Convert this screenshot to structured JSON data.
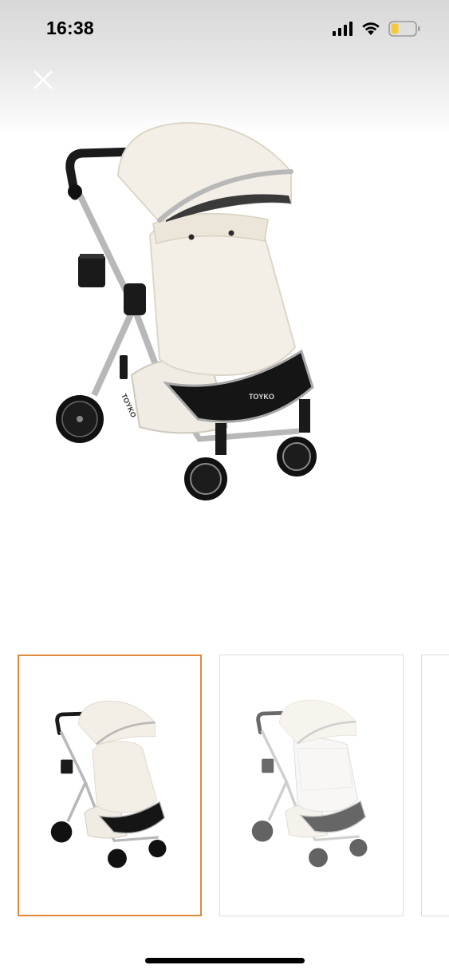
{
  "status_bar": {
    "time": "16:38",
    "icons": [
      "signal-icon",
      "wifi-icon",
      "battery-icon"
    ],
    "battery_color": "#f6c83a"
  },
  "toolbar": {
    "close_icon": "close-icon"
  },
  "product": {
    "brand_label": "TOYKO",
    "main_image_alt": "Beige baby stroller"
  },
  "gallery": {
    "selected_index": 0,
    "selected_border_color": "#e08a3c",
    "thumbnails": [
      {
        "label": "stroller-with-footmuff"
      },
      {
        "label": "stroller-with-mosquito-net"
      },
      {
        "label": "stroller-more"
      }
    ]
  }
}
